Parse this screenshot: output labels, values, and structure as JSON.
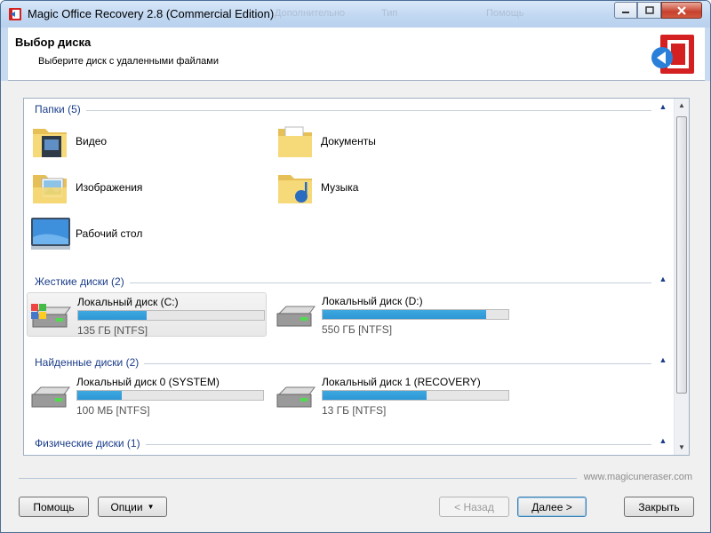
{
  "window": {
    "title": "Magic Office Recovery 2.8 (Commercial Edition)",
    "ghost_menu": [
      "Дополнительно",
      "Тип",
      "Помощь"
    ]
  },
  "header": {
    "title": "Выбор диска",
    "subtitle": "Выберите диск с удаленными файлами"
  },
  "sections": {
    "folders": {
      "label": "Папки (5)",
      "items": [
        "Видео",
        "Документы",
        "Изображения",
        "Музыка",
        "Рабочий стол"
      ]
    },
    "hard_disks": {
      "label": "Жесткие диски (2)",
      "drives": [
        {
          "name": "Локальный диск (C:)",
          "info": "135 ГБ [NTFS]",
          "used_fraction": 0.37
        },
        {
          "name": "Локальный диск (D:)",
          "info": "550 ГБ [NTFS]",
          "used_fraction": 0.88
        }
      ]
    },
    "found_disks": {
      "label": "Найденные диски (2)",
      "drives": [
        {
          "name": "Локальный диск 0 (SYSTEM)",
          "info": "100 МБ [NTFS]",
          "used_fraction": 0.24
        },
        {
          "name": "Локальный диск 1 (RECOVERY)",
          "info": "13 ГБ [NTFS]",
          "used_fraction": 0.56
        }
      ]
    },
    "physical_disks": {
      "label": "Физические диски (1)"
    }
  },
  "footer": {
    "watermark": "www.magicuneraser.com",
    "help": "Помощь",
    "options": "Опции",
    "back": "< Назад",
    "next": "Далее >",
    "close": "Закрыть"
  },
  "colors": {
    "section_label": "#1a3d8a",
    "progress_fill": "#2c97d6"
  }
}
